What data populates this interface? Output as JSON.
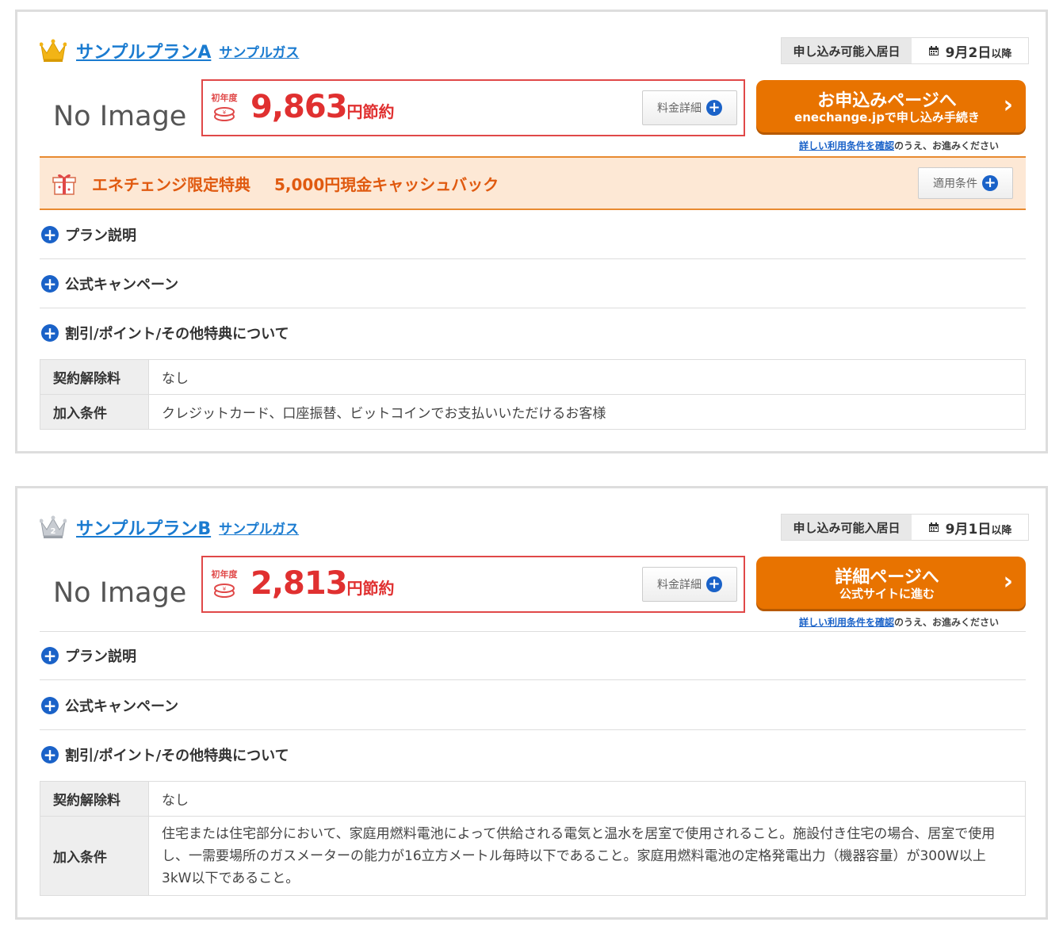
{
  "colors": {
    "link": "#1a7bd0",
    "savings": "#e03030",
    "cta": "#e87300",
    "benefit_bg": "#fde8d5",
    "plus": "#1a62c8"
  },
  "plans": [
    {
      "rank": "1",
      "name": "サンプルプランA",
      "provider": "サンプルガス",
      "avail_label": "申し込み可能入居日",
      "avail_date": "9月2日",
      "avail_suffix": "以降",
      "no_image": "No Image",
      "first_year": "初年度",
      "savings_amount": "9,863",
      "savings_unit": "円節約",
      "detail_button": "料金詳細",
      "cta_main": "お申込みページへ",
      "cta_sub": "enechange.jpで申し込み手続き",
      "terms_link": "詳しい利用条件を確認",
      "terms_suffix": "のうえ、お進みください",
      "benefit_label": "エネチェンジ限定特典",
      "benefit_text": "5,000円現金キャッシュバック",
      "benefit_button": "適用条件",
      "accordion": [
        "プラン説明",
        "公式キャンペーン",
        "割引/ポイント/その他特典について"
      ],
      "table": [
        {
          "label": "契約解除料",
          "value": "なし"
        },
        {
          "label": "加入条件",
          "value": "クレジットカード、口座振替、ビットコインでお支払いいただけるお客様"
        }
      ]
    },
    {
      "rank": "2",
      "name": "サンプルプランB",
      "provider": "サンプルガス",
      "avail_label": "申し込み可能入居日",
      "avail_date": "9月1日",
      "avail_suffix": "以降",
      "no_image": "No Image",
      "first_year": "初年度",
      "savings_amount": "2,813",
      "savings_unit": "円節約",
      "detail_button": "料金詳細",
      "cta_main": "詳細ページへ",
      "cta_sub": "公式サイトに進む",
      "terms_link": "詳しい利用条件を確認",
      "terms_suffix": "のうえ、お進みください",
      "accordion": [
        "プラン説明",
        "公式キャンペーン",
        "割引/ポイント/その他特典について"
      ],
      "table": [
        {
          "label": "契約解除料",
          "value": "なし"
        },
        {
          "label": "加入条件",
          "value": "住宅または住宅部分において、家庭用燃料電池によって供給される電気と温水を居室で使用されること。施設付き住宅の場合、居室で使用し、一需要場所のガスメーターの能力が16立方メートル毎時以下であること。家庭用燃料電池の定格発電出力（機器容量）が300W以上3kW以下であること。"
        }
      ]
    }
  ]
}
